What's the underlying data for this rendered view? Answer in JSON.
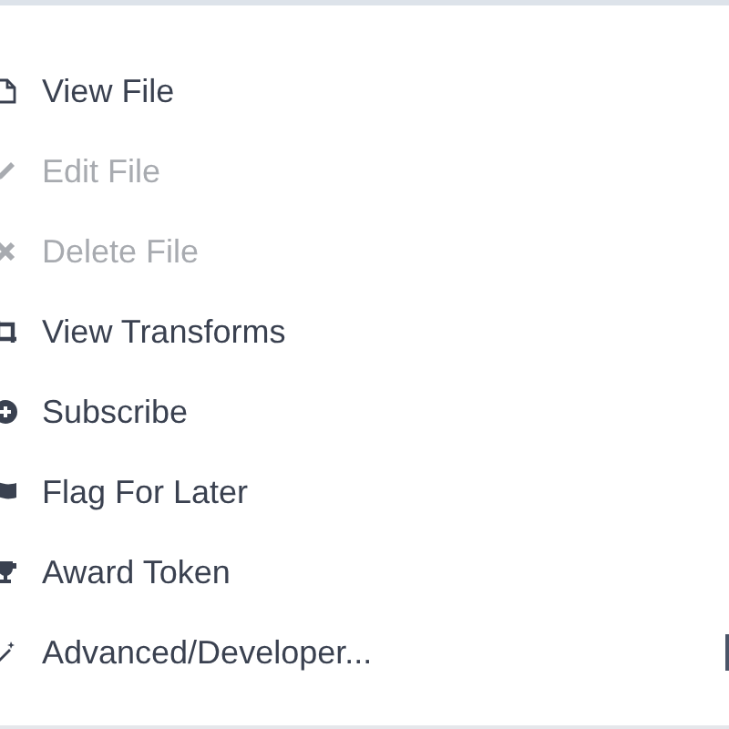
{
  "menu": {
    "items": [
      {
        "label": "View File",
        "kind": "file",
        "disabled": false
      },
      {
        "label": "Edit File",
        "kind": "pencil",
        "disabled": true
      },
      {
        "label": "Delete File",
        "kind": "times",
        "disabled": true
      },
      {
        "label": "View Transforms",
        "kind": "crop",
        "disabled": false
      },
      {
        "label": "Subscribe",
        "kind": "plus",
        "disabled": false
      },
      {
        "label": "Flag For Later",
        "kind": "flag",
        "disabled": false
      },
      {
        "label": "Award Token",
        "kind": "trophy",
        "disabled": false
      },
      {
        "label": "Advanced/Developer...",
        "kind": "magic",
        "disabled": false
      }
    ]
  }
}
